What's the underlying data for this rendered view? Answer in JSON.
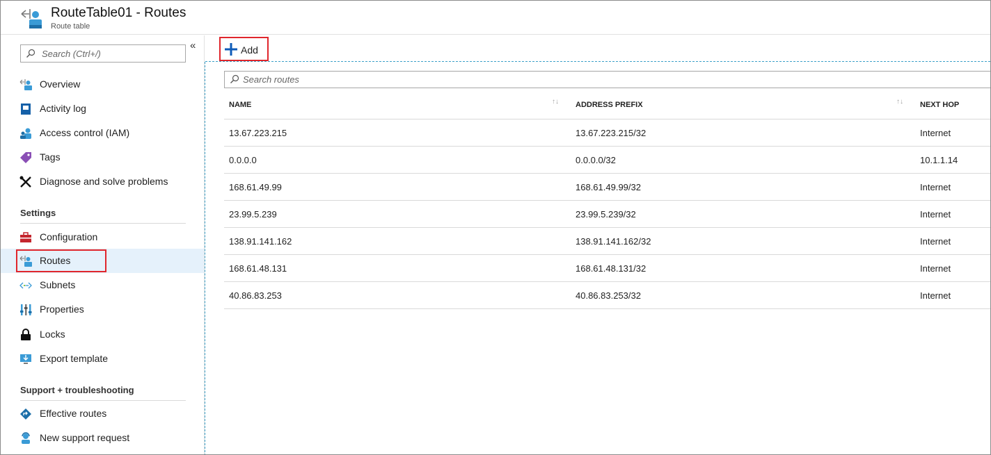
{
  "header": {
    "title": "RouteTable01 - Routes",
    "subtitle": "Route table"
  },
  "sidebar": {
    "search_placeholder": "Search (Ctrl+/)",
    "collapse_glyph": "«",
    "items": [
      {
        "label": "Overview",
        "icon": "route-table-icon"
      },
      {
        "label": "Activity log",
        "icon": "activity-log-icon"
      },
      {
        "label": "Access control (IAM)",
        "icon": "users-icon"
      },
      {
        "label": "Tags",
        "icon": "tag-icon"
      },
      {
        "label": "Diagnose and solve problems",
        "icon": "wrench-icon"
      }
    ],
    "settings_heading": "Settings",
    "settings_items": [
      {
        "label": "Configuration",
        "icon": "toolbox-icon"
      },
      {
        "label": "Routes",
        "icon": "route-table-icon",
        "selected": true
      },
      {
        "label": "Subnets",
        "icon": "subnet-icon"
      },
      {
        "label": "Properties",
        "icon": "properties-icon"
      },
      {
        "label": "Locks",
        "icon": "lock-icon"
      },
      {
        "label": "Export template",
        "icon": "export-template-icon"
      }
    ],
    "support_heading": "Support + troubleshooting",
    "support_items": [
      {
        "label": "Effective routes",
        "icon": "effective-routes-icon"
      },
      {
        "label": "New support request",
        "icon": "support-person-icon"
      }
    ]
  },
  "toolbar": {
    "add_label": "Add",
    "add_icon": "plus-icon"
  },
  "routes": {
    "search_placeholder": "Search routes",
    "columns": [
      "NAME",
      "ADDRESS PREFIX",
      "NEXT HOP"
    ],
    "rows": [
      {
        "name": "13.67.223.215",
        "prefix": "13.67.223.215/32",
        "next_hop": "Internet"
      },
      {
        "name": "0.0.0.0",
        "prefix": "0.0.0.0/32",
        "next_hop": "10.1.1.14"
      },
      {
        "name": "168.61.49.99",
        "prefix": "168.61.49.99/32",
        "next_hop": "Internet"
      },
      {
        "name": "23.99.5.239",
        "prefix": "23.99.5.239/32",
        "next_hop": "Internet"
      },
      {
        "name": "138.91.141.162",
        "prefix": "138.91.141.162/32",
        "next_hop": "Internet"
      },
      {
        "name": "168.61.48.131",
        "prefix": "168.61.48.131/32",
        "next_hop": "Internet"
      },
      {
        "name": "40.86.83.253",
        "prefix": "40.86.83.253/32",
        "next_hop": "Internet"
      }
    ]
  },
  "colors": {
    "accent": "#0078d4",
    "highlight_border": "#e0262c",
    "selected_bg": "#e5f1fb",
    "dashed_border": "#3aa0c8"
  }
}
